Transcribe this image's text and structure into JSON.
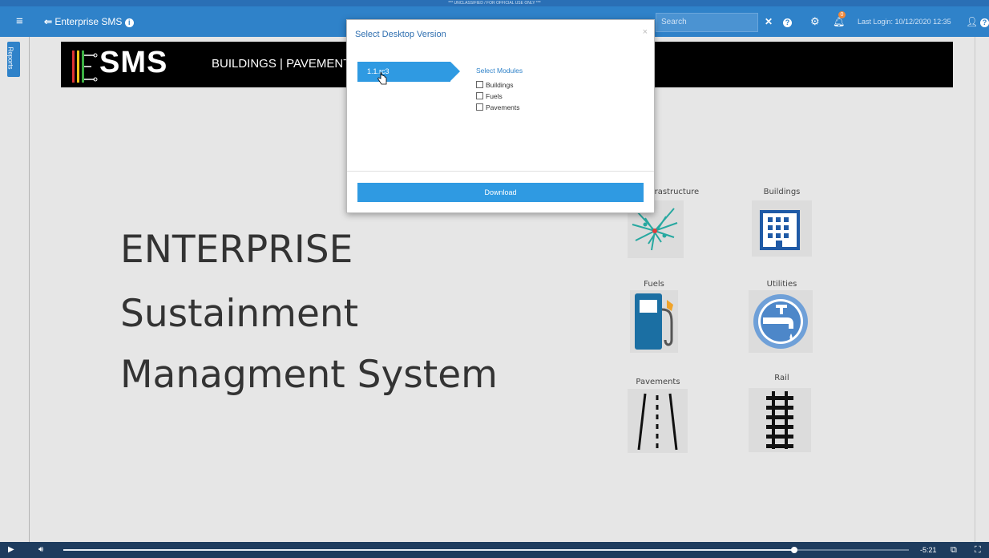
{
  "classification_banner": "*** UNCLASSIFIED / FOR OFFICIAL USE ONLY ***",
  "topbar": {
    "app_name": "Enterprise SMS",
    "search_placeholder": "Search",
    "notification_count": "0",
    "last_login": "Last Login: 10/12/2020 12:35"
  },
  "sidebar": {
    "reports_label": "Reports"
  },
  "banner": {
    "logo_text": "SMS",
    "modules_text": "BUILDINGS | PAVEMENTS"
  },
  "hero": {
    "line1": "ENTERPRISE",
    "line2": "Sustainment",
    "line3": "Managment System"
  },
  "tiles": {
    "infrastructure": "Infrastructure",
    "buildings": "Buildings",
    "fuels": "Fuels",
    "utilities": "Utilities",
    "pavements": "Pavements",
    "rail": "Rail"
  },
  "modal": {
    "title": "Select Desktop Version",
    "close": "×",
    "version": "1.1.rc3",
    "modules_title": "Select Modules",
    "modules": [
      "Buildings",
      "Fuels",
      "Pavements"
    ],
    "download_label": "Download"
  },
  "player": {
    "time_remaining": "-5:21",
    "progress": 0.864
  },
  "colors": {
    "primary": "#2f82c9",
    "button": "#2f9ae2",
    "player": "#1e3c5e",
    "banner": "#000000"
  }
}
